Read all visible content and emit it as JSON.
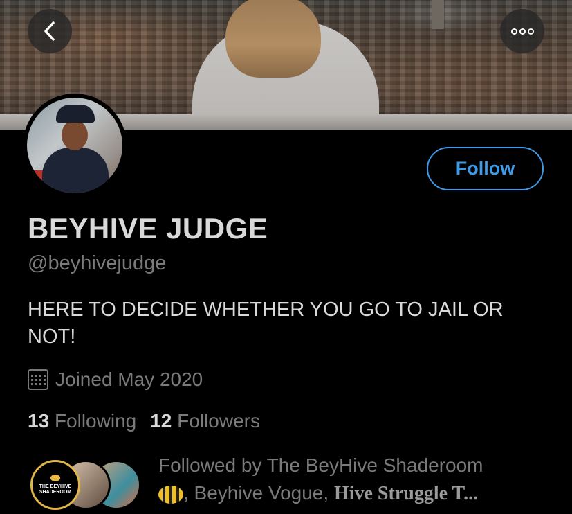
{
  "header": {
    "back_icon": "chevron-left-icon",
    "more_icon": "more-dots-icon"
  },
  "profile": {
    "display_name": "BEYHIVE JUDGE",
    "handle": "@beyhivejudge",
    "bio": "HERE TO DECIDE WHETHER YOU GO TO JAIL OR NOT!",
    "joined": "Joined May 2020",
    "follow_label": "Follow",
    "following_count": "13",
    "following_label": "Following",
    "followers_count": "12",
    "followers_label": "Followers"
  },
  "followed_by": {
    "line1": "Followed by The BeyHive Shaderoom",
    "sep": ", Beyhive Vogue, ",
    "last": "Hive Struggle T...",
    "avatar1_text": "THE BEYHIVE SHADEROOM"
  },
  "colors": {
    "accent": "#3d9be9",
    "background": "#000000",
    "text_primary": "#d9d9d9",
    "text_secondary": "#7a7a7a"
  }
}
